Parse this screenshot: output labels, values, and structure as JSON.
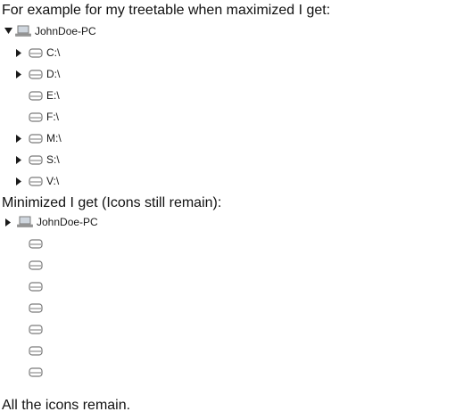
{
  "text": {
    "intro": "For example for my treetable when maximized I get:",
    "minimized": "Minimized I get (Icons still remain):",
    "outro": "All the icons remain."
  },
  "maximized": {
    "root": {
      "label": "JohnDoe-PC",
      "icon": "computer-icon",
      "expanded": true
    },
    "drives": [
      {
        "label": "C:\\",
        "icon": "drive-icon",
        "has_children": true
      },
      {
        "label": "D:\\",
        "icon": "drive-icon",
        "has_children": true
      },
      {
        "label": "E:\\",
        "icon": "drive-icon",
        "has_children": false
      },
      {
        "label": "F:\\",
        "icon": "drive-icon",
        "has_children": false
      },
      {
        "label": "M:\\",
        "icon": "drive-icon",
        "has_children": true
      },
      {
        "label": "S:\\",
        "icon": "drive-icon",
        "has_children": true
      },
      {
        "label": "V:\\",
        "icon": "drive-icon",
        "has_children": true
      }
    ]
  },
  "minimized_tree": {
    "root": {
      "label": "JohnDoe-PC",
      "icon": "computer-icon",
      "expanded": false
    },
    "orphan_icons": [
      "drive-icon",
      "drive-icon",
      "drive-icon",
      "drive-icon",
      "drive-icon",
      "drive-icon",
      "drive-icon"
    ]
  },
  "colors": {
    "icon_stroke": "#7a7a7a",
    "arrow_fill": "#1a1a1a",
    "screen_fill": "#cfd6de"
  }
}
